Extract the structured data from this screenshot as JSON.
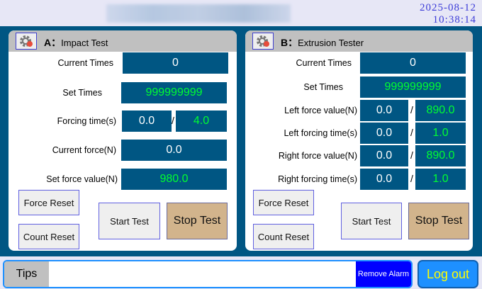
{
  "header": {
    "date": "2025-08-12",
    "time": "10:38:14"
  },
  "panel_a": {
    "letter": "A：",
    "title": "Impact Test",
    "current_times": {
      "label": "Current  Times",
      "value": "0"
    },
    "set_times": {
      "label": "Set Times",
      "value": "999999999"
    },
    "forcing_time": {
      "label": "Forcing time(s)",
      "current": "0.0",
      "set": "4.0"
    },
    "current_force": {
      "label": "Current force(N)",
      "value": "0.0"
    },
    "set_force": {
      "label": "Set force value(N)",
      "value": "980.0"
    },
    "buttons": {
      "force_reset": "Force Reset",
      "count_reset": "Count Reset",
      "start": "Start Test",
      "stop": "Stop Test"
    }
  },
  "panel_b": {
    "letter": "B：",
    "title": "Extrusion Tester",
    "current_times": {
      "label": "Current  Times",
      "value": "0"
    },
    "set_times": {
      "label": "Set Times",
      "value": "999999999"
    },
    "left_force": {
      "label": "Left force value(N)",
      "current": "0.0",
      "set": "890.0"
    },
    "left_time": {
      "label": "Left  forcing time(s)",
      "current": "0.0",
      "set": "1.0"
    },
    "right_force": {
      "label": "Right force value(N)",
      "current": "0.0",
      "set": "890.0"
    },
    "right_time": {
      "label": "Right forcing time(s)",
      "current": "0.0",
      "set": "1.0"
    },
    "buttons": {
      "force_reset": "Force Reset",
      "count_reset": "Count Reset",
      "start": "Start Test",
      "stop": "Stop Test"
    }
  },
  "footer": {
    "tips_label": "Tips",
    "tips_text": "",
    "remove_alarm": "Remove Alarm",
    "logout": "Log out"
  },
  "slash": "/",
  "colors": {
    "value_box": "#005683",
    "set_value_text": "#00ff30",
    "stop_button": "#d2b48c",
    "remove_alarm": "#0000ff",
    "logout": "#1e90ff"
  }
}
